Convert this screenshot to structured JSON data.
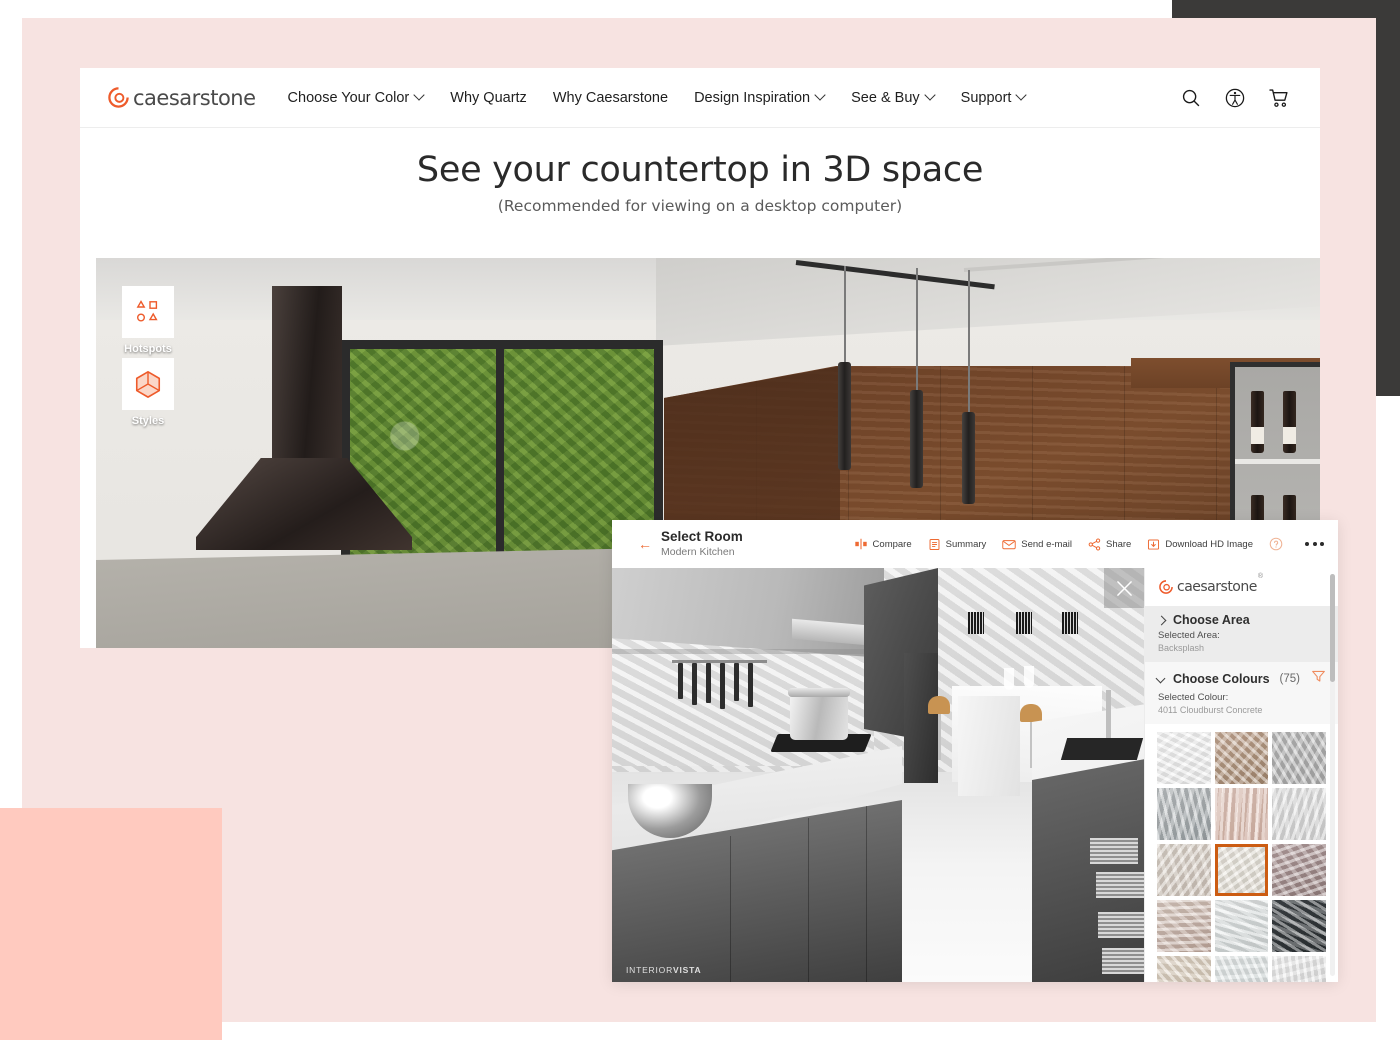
{
  "theme": {
    "accent": "#ee6a33",
    "accent_dark": "#cc5c12",
    "page_bg_pink": "#f7e3e1",
    "accent_salmon": "#ffcabf",
    "dark_bar": "#3b3a39"
  },
  "nav": {
    "brand": "caesarstone",
    "items": [
      {
        "label": "Choose Your Color",
        "has_caret": true
      },
      {
        "label": "Why Quartz",
        "has_caret": false
      },
      {
        "label": "Why Caesarstone",
        "has_caret": false
      },
      {
        "label": "Design Inspiration",
        "has_caret": true
      },
      {
        "label": "See & Buy",
        "has_caret": true
      },
      {
        "label": "Support",
        "has_caret": true
      }
    ],
    "icons": [
      {
        "name": "search-icon"
      },
      {
        "name": "accessibility-icon"
      },
      {
        "name": "cart-icon"
      }
    ]
  },
  "hero": {
    "title": "See your countertop in 3D space",
    "subtitle": "(Recommended for viewing on a desktop computer)"
  },
  "viewer": {
    "buttons": [
      {
        "label": "Hotspots",
        "icon": "hotspots-icon"
      },
      {
        "label": "Styles",
        "icon": "styles-cube-icon"
      }
    ]
  },
  "overlay": {
    "back_arrow": "←",
    "title": "Select Room",
    "subtitle": "Modern Kitchen",
    "tools": [
      {
        "label": "Compare",
        "icon": "compare-icon"
      },
      {
        "label": "Summary",
        "icon": "summary-icon"
      },
      {
        "label": "Send e-mail",
        "icon": "email-icon"
      },
      {
        "label": "Share",
        "icon": "share-icon"
      },
      {
        "label": "Download HD Image",
        "icon": "download-icon"
      }
    ],
    "help_icon": "help-icon",
    "more_menu": "more-options-icon",
    "close_label": "✕",
    "watermark_light": "INTERIOR",
    "watermark_bold": "VISTA"
  },
  "sidebar": {
    "brand": "caesarstone",
    "brand_reg": "®",
    "sections": [
      {
        "title": "Choose Area",
        "count": "",
        "expanded": false,
        "sub_label": "Selected Area:",
        "value": "Backsplash"
      },
      {
        "title": "Choose Colours",
        "count": "(75)",
        "expanded": true,
        "sub_label": "Selected Colour:",
        "value": "4011 Cloudburst Concrete"
      }
    ],
    "filter_icon": "filter-funnel-icon",
    "swatches": [
      {
        "name": "white-marble-veined",
        "c1": "#fafafa",
        "c2": "#eeeeee",
        "selected": false
      },
      {
        "name": "beige-brown-marble",
        "c1": "#c8ab95",
        "c2": "#a88b72",
        "selected": false
      },
      {
        "name": "grey-solid",
        "c1": "#bdbdbd",
        "c2": "#acacac",
        "selected": false
      },
      {
        "name": "grey-marble",
        "c1": "#c0c4c6",
        "c2": "#9ea5a8",
        "selected": false
      },
      {
        "name": "blush-pink-stone",
        "c1": "#e9cec3",
        "c2": "#ddb9ab",
        "selected": false
      },
      {
        "name": "light-grey-plain",
        "c1": "#e5e5e5",
        "c2": "#dadada",
        "selected": false
      },
      {
        "name": "warm-greige",
        "c1": "#ded5cc",
        "c2": "#d2c7bc",
        "selected": false
      },
      {
        "name": "4011-cloudburst-concrete",
        "c1": "#eeeae2",
        "c2": "#e2ddd3",
        "selected": true
      },
      {
        "name": "mauve-textured-stone",
        "c1": "#b9a3a3",
        "c2": "#96807f",
        "selected": false
      },
      {
        "name": "cream-veined-marble",
        "c1": "#ddcdc3",
        "c2": "#c3aa9f",
        "selected": false
      },
      {
        "name": "white-speckled-quartz",
        "c1": "#e9ecec",
        "c2": "#d5dbdb",
        "selected": false
      },
      {
        "name": "dark-charcoal-stone",
        "c1": "#3e4347",
        "c2": "#2b3033",
        "selected": false
      },
      {
        "name": "sand-beige-plain",
        "c1": "#e4d8c9",
        "c2": "#d8c9b6",
        "selected": false
      },
      {
        "name": "soft-white-marble",
        "c1": "#e6ebeb",
        "c2": "#dbe2e2",
        "selected": false
      },
      {
        "name": "bold-veined-white-marble",
        "c1": "#f3f3f3",
        "c2": "#dcdcdc",
        "selected": false
      }
    ]
  }
}
